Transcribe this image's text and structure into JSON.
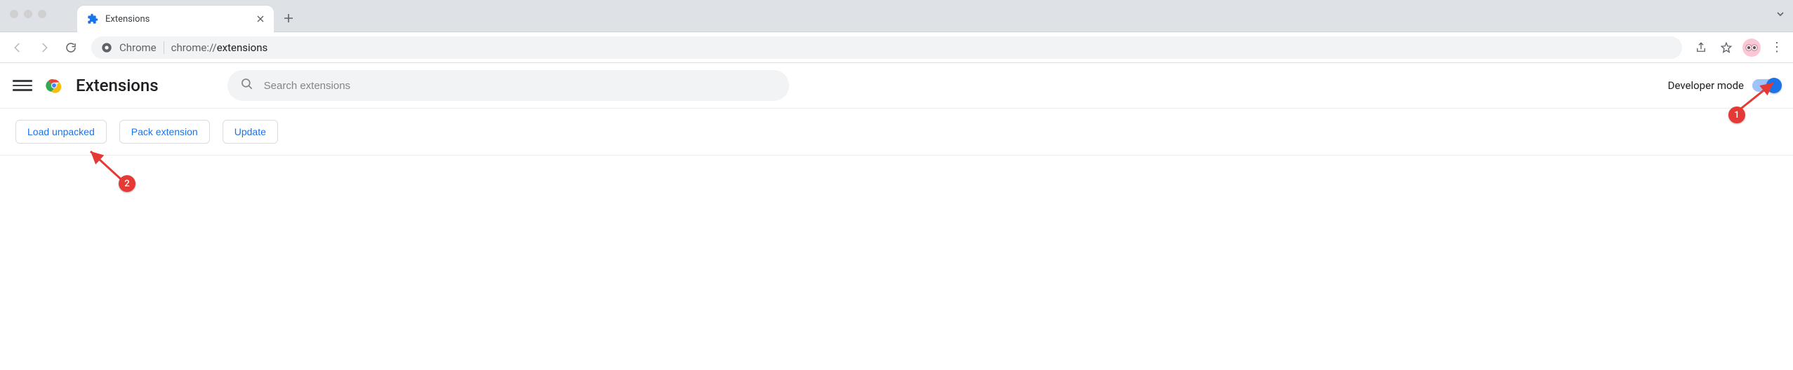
{
  "tab": {
    "title": "Extensions"
  },
  "omnibox": {
    "label": "Chrome",
    "url_prefix": "chrome://",
    "url_strong": "extensions"
  },
  "header": {
    "title": "Extensions",
    "search_placeholder": "Search extensions",
    "developer_mode_label": "Developer mode",
    "developer_mode_on": true
  },
  "actions": {
    "load_unpacked": "Load unpacked",
    "pack_extension": "Pack extension",
    "update": "Update"
  },
  "annotations": {
    "one": "1",
    "two": "2"
  }
}
